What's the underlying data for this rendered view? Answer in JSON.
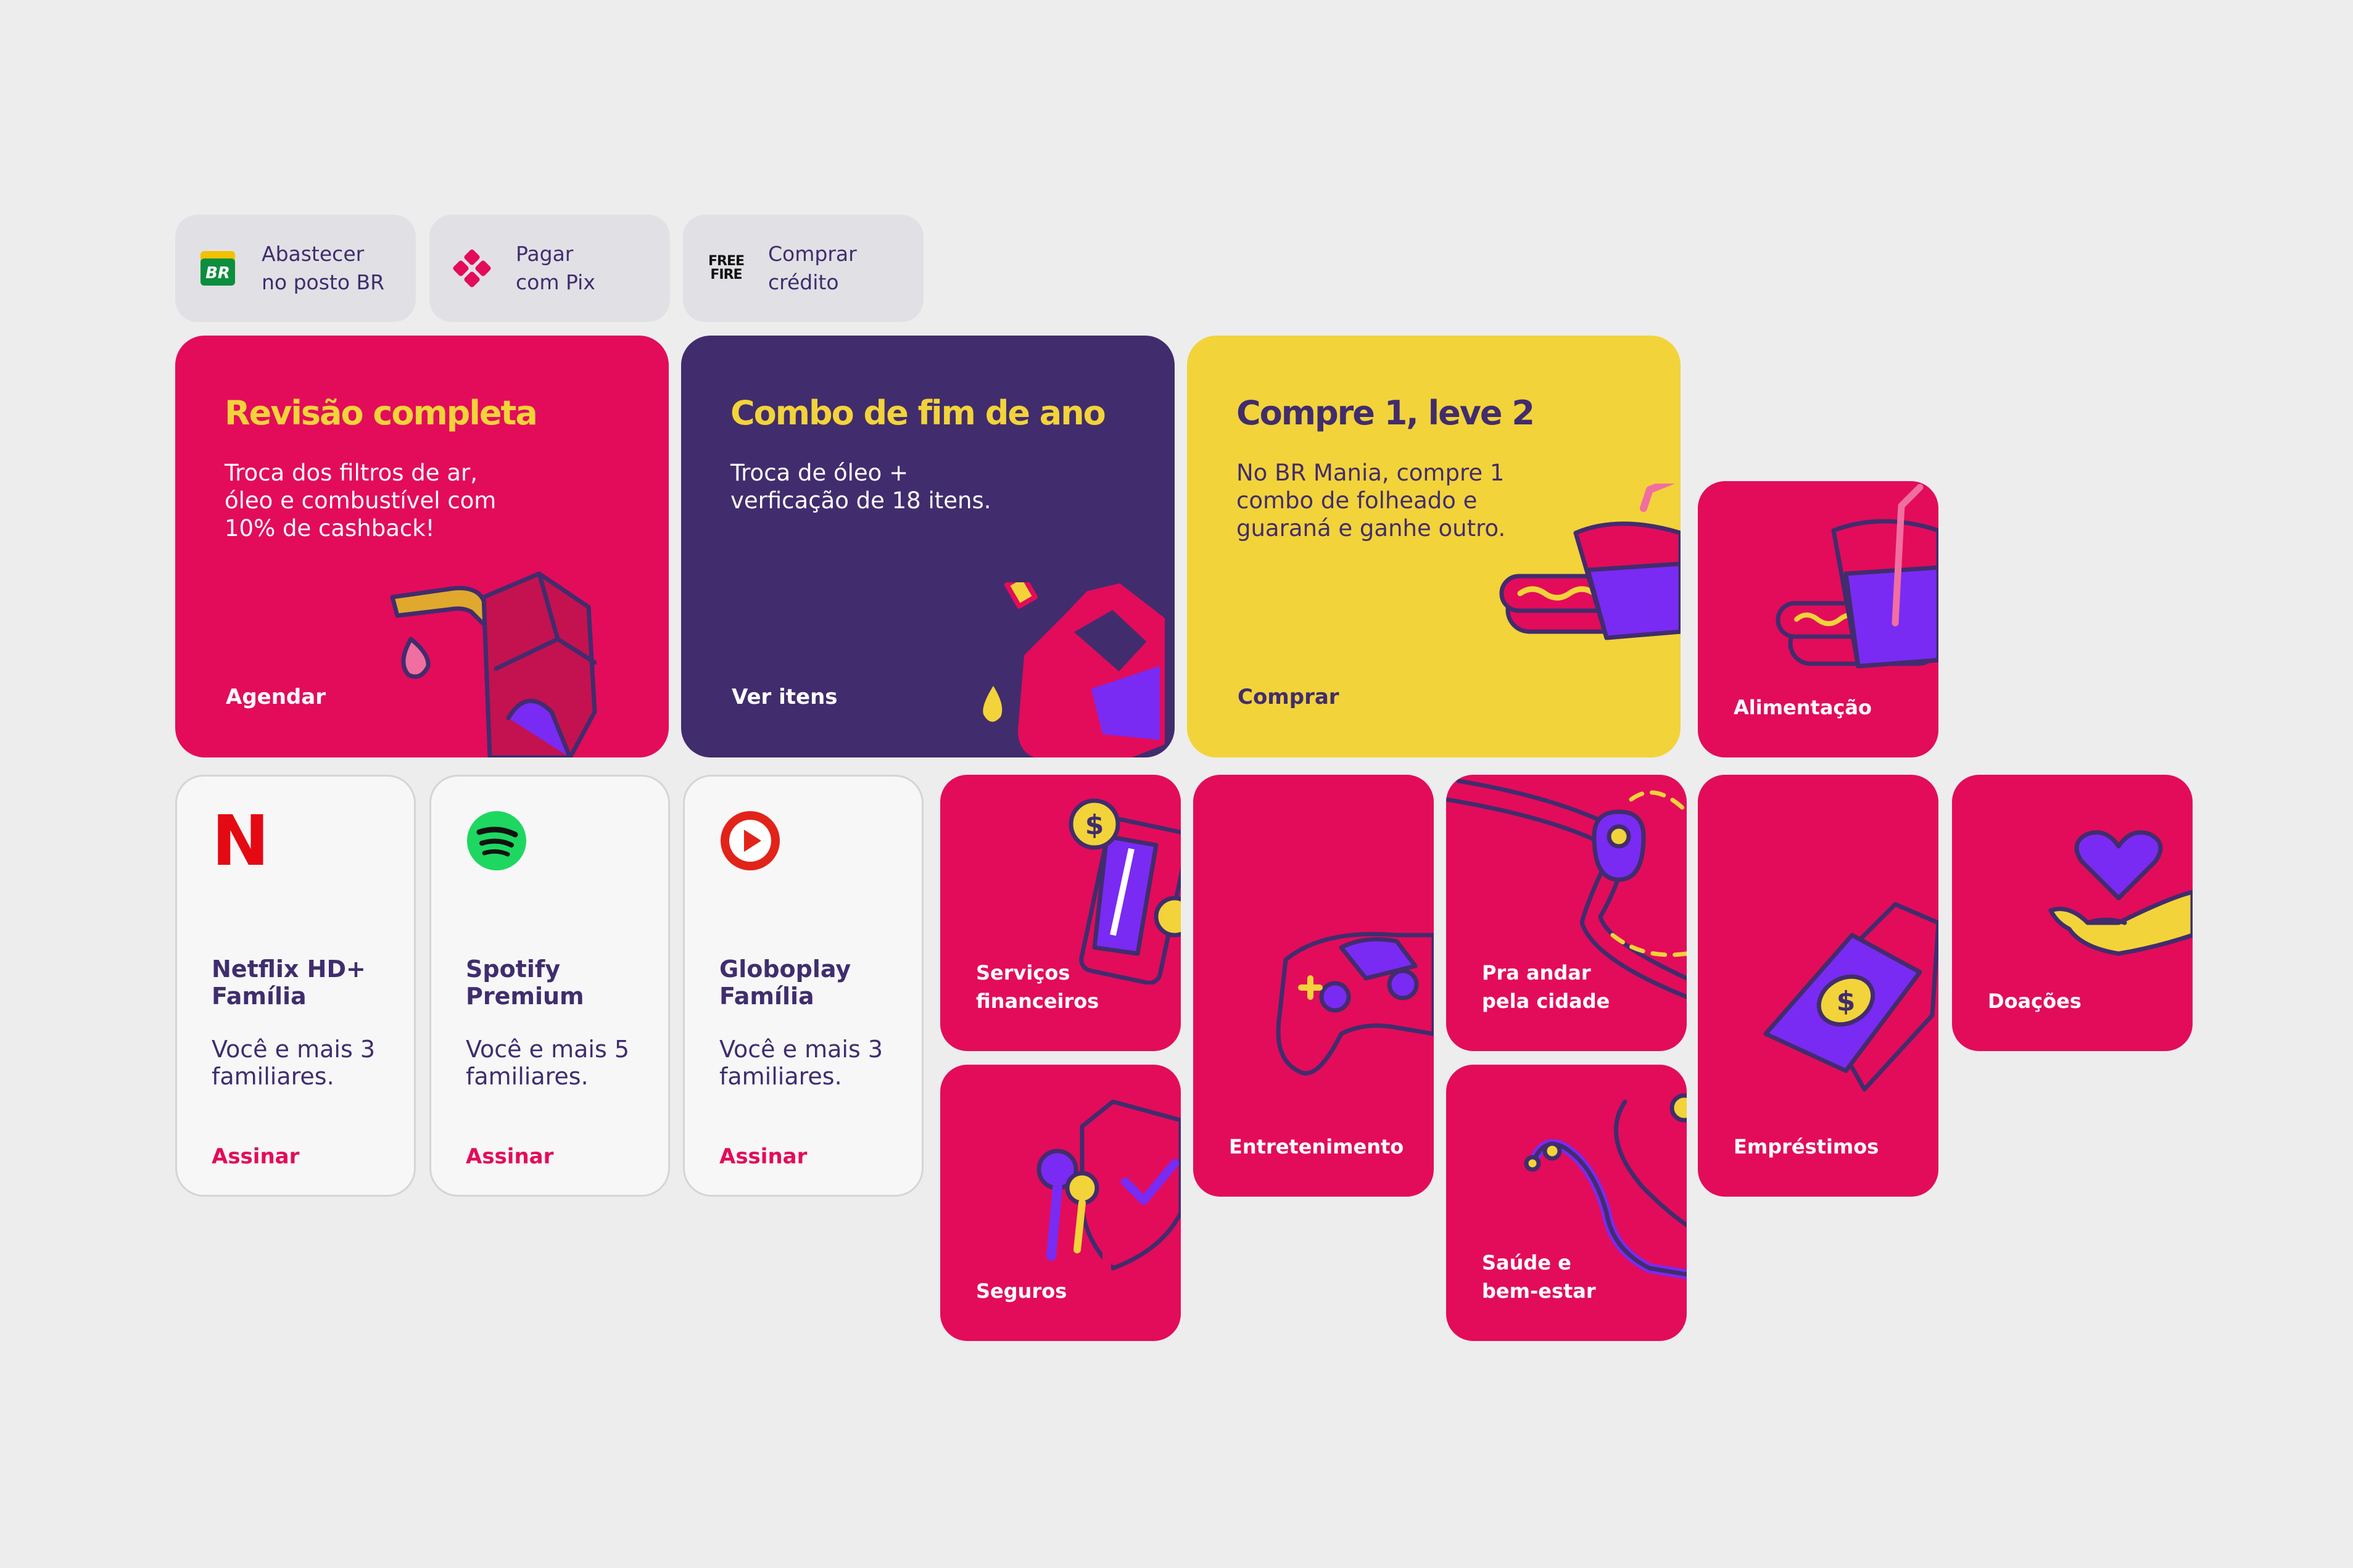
{
  "colors": {
    "background": "#EDEDED",
    "pink": "#E20C5A",
    "purple": "#412C6E",
    "yellow": "#F2D33A",
    "violet": "#7A2BF3",
    "chip_bg": "#E1E0E5",
    "card_bg": "#F7F7F7"
  },
  "quick_actions": [
    {
      "icon": "br-logo-icon",
      "line1": "Abastecer",
      "line2": "no posto BR"
    },
    {
      "icon": "pix-icon",
      "line1": "Pagar",
      "line2": "com Pix"
    },
    {
      "icon": "free-fire-logo-icon",
      "line1": "Comprar",
      "line2": "crédito",
      "logo_text_1": "FREE",
      "logo_text_2": "FIRE"
    }
  ],
  "promos": [
    {
      "title": "Revisão completa",
      "desc": [
        "Troca dos filtros de ar,",
        "óleo e combustível com",
        "10% de cashback!"
      ],
      "cta": "Agendar",
      "bg": "#E20C5A",
      "title_color": "#F2D33A",
      "text_color": "#FFFFFF",
      "icon": "fuel-pump-icon"
    },
    {
      "title": "Combo de fim de ano",
      "desc": [
        "Troca de óleo +",
        "verficação de 18 itens."
      ],
      "cta": "Ver itens",
      "bg": "#412C6E",
      "title_color": "#F2D33A",
      "text_color": "#FFFFFF",
      "icon": "oil-can-icon"
    },
    {
      "title": "Compre 1, leve 2",
      "desc": [
        "No BR Mania, compre 1",
        "combo de folheado e",
        "guaraná e ganhe outro."
      ],
      "cta": "Comprar",
      "bg": "#F2D33A",
      "title_color": "#412C6E",
      "text_color": "#412C6E",
      "icon": "hotdog-drink-icon"
    }
  ],
  "subscriptions": [
    {
      "name": [
        "Netflix HD+",
        "Família"
      ],
      "desc": [
        "Você e mais 3",
        "familiares."
      ],
      "cta": "Assinar",
      "icon": "netflix-icon",
      "logo_text": "N"
    },
    {
      "name": [
        "Spotify",
        "Premium"
      ],
      "desc": [
        "Você e mais 5",
        "familiares."
      ],
      "cta": "Assinar",
      "icon": "spotify-icon"
    },
    {
      "name": [
        "Globoplay",
        "Família"
      ],
      "desc": [
        "Você e mais 3",
        "familiares."
      ],
      "cta": "Assinar",
      "icon": "globoplay-icon"
    }
  ],
  "categories": {
    "alimentacao": {
      "label": [
        "Alimentação"
      ],
      "icon": "food-icon"
    },
    "servicos": {
      "label": [
        "Serviços",
        "financeiros"
      ],
      "icon": "phone-coins-icon"
    },
    "seguros": {
      "label": [
        "Seguros"
      ],
      "icon": "keys-shield-icon"
    },
    "entretenimento": {
      "label": [
        "Entretenimento"
      ],
      "icon": "gamepad-icon"
    },
    "cidade": {
      "label": [
        "Pra andar",
        "pela cidade"
      ],
      "icon": "map-pin-icon"
    },
    "saude": {
      "label": [
        "Saúde e",
        "bem-estar"
      ],
      "icon": "stethoscope-icon"
    },
    "emprestimos": {
      "label": [
        "Empréstimos"
      ],
      "icon": "money-bill-icon"
    },
    "doacoes": {
      "label": [
        "Doações"
      ],
      "icon": "heart-hand-icon"
    }
  }
}
